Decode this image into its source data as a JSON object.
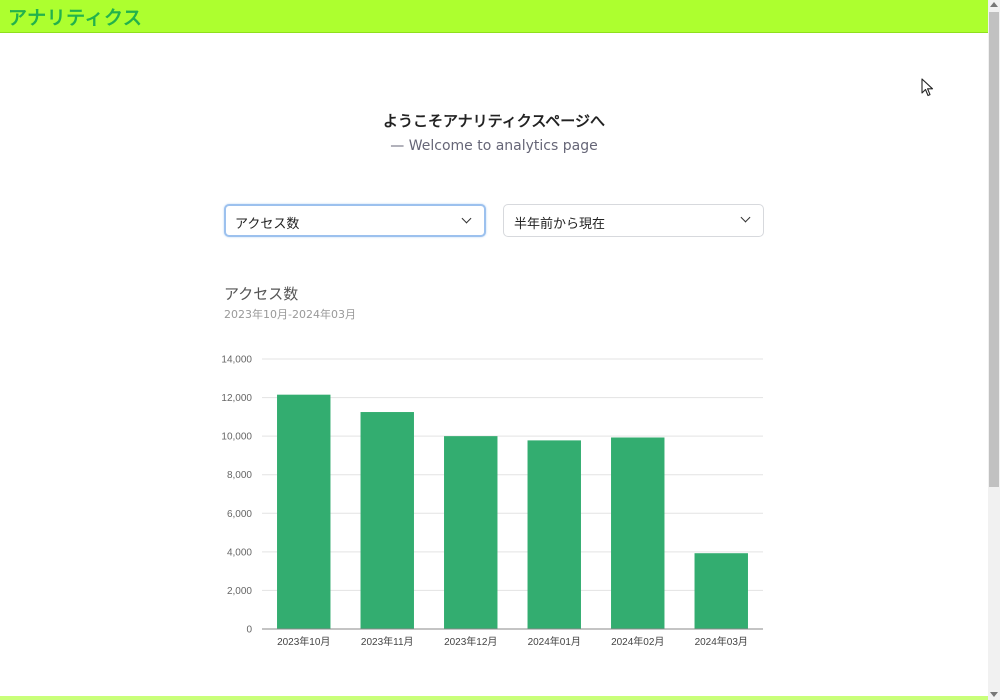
{
  "app": {
    "title": "アナリティクス"
  },
  "welcome": {
    "title": "ようこそアナリティクスページへ",
    "subtitle": "—  Welcome to analytics page"
  },
  "filters": {
    "metric": {
      "selected": "アクセス数"
    },
    "range": {
      "selected": "半年前から現在"
    }
  },
  "colors": {
    "topbar": "#adff2f",
    "title_text": "#22b24c",
    "bar": "#33ad70"
  },
  "icons": {
    "dropdown": "chevron-down-icon",
    "cursor": "mouse-pointer-icon"
  },
  "chart_data": {
    "type": "bar",
    "title": "アクセス数",
    "subtitle": "2023年10月-2024年03月",
    "categories": [
      "2023年10月",
      "2023年11月",
      "2023年12月",
      "2024年01月",
      "2024年02月",
      "2024年03月"
    ],
    "values": [
      12150,
      11250,
      10000,
      9780,
      9930,
      3930
    ],
    "ylim": [
      0,
      14000
    ],
    "yticks": [
      "0",
      "2,000",
      "4,000",
      "6,000",
      "8,000",
      "10,000",
      "12,000",
      "14,000"
    ],
    "grid": true,
    "legend": false
  }
}
